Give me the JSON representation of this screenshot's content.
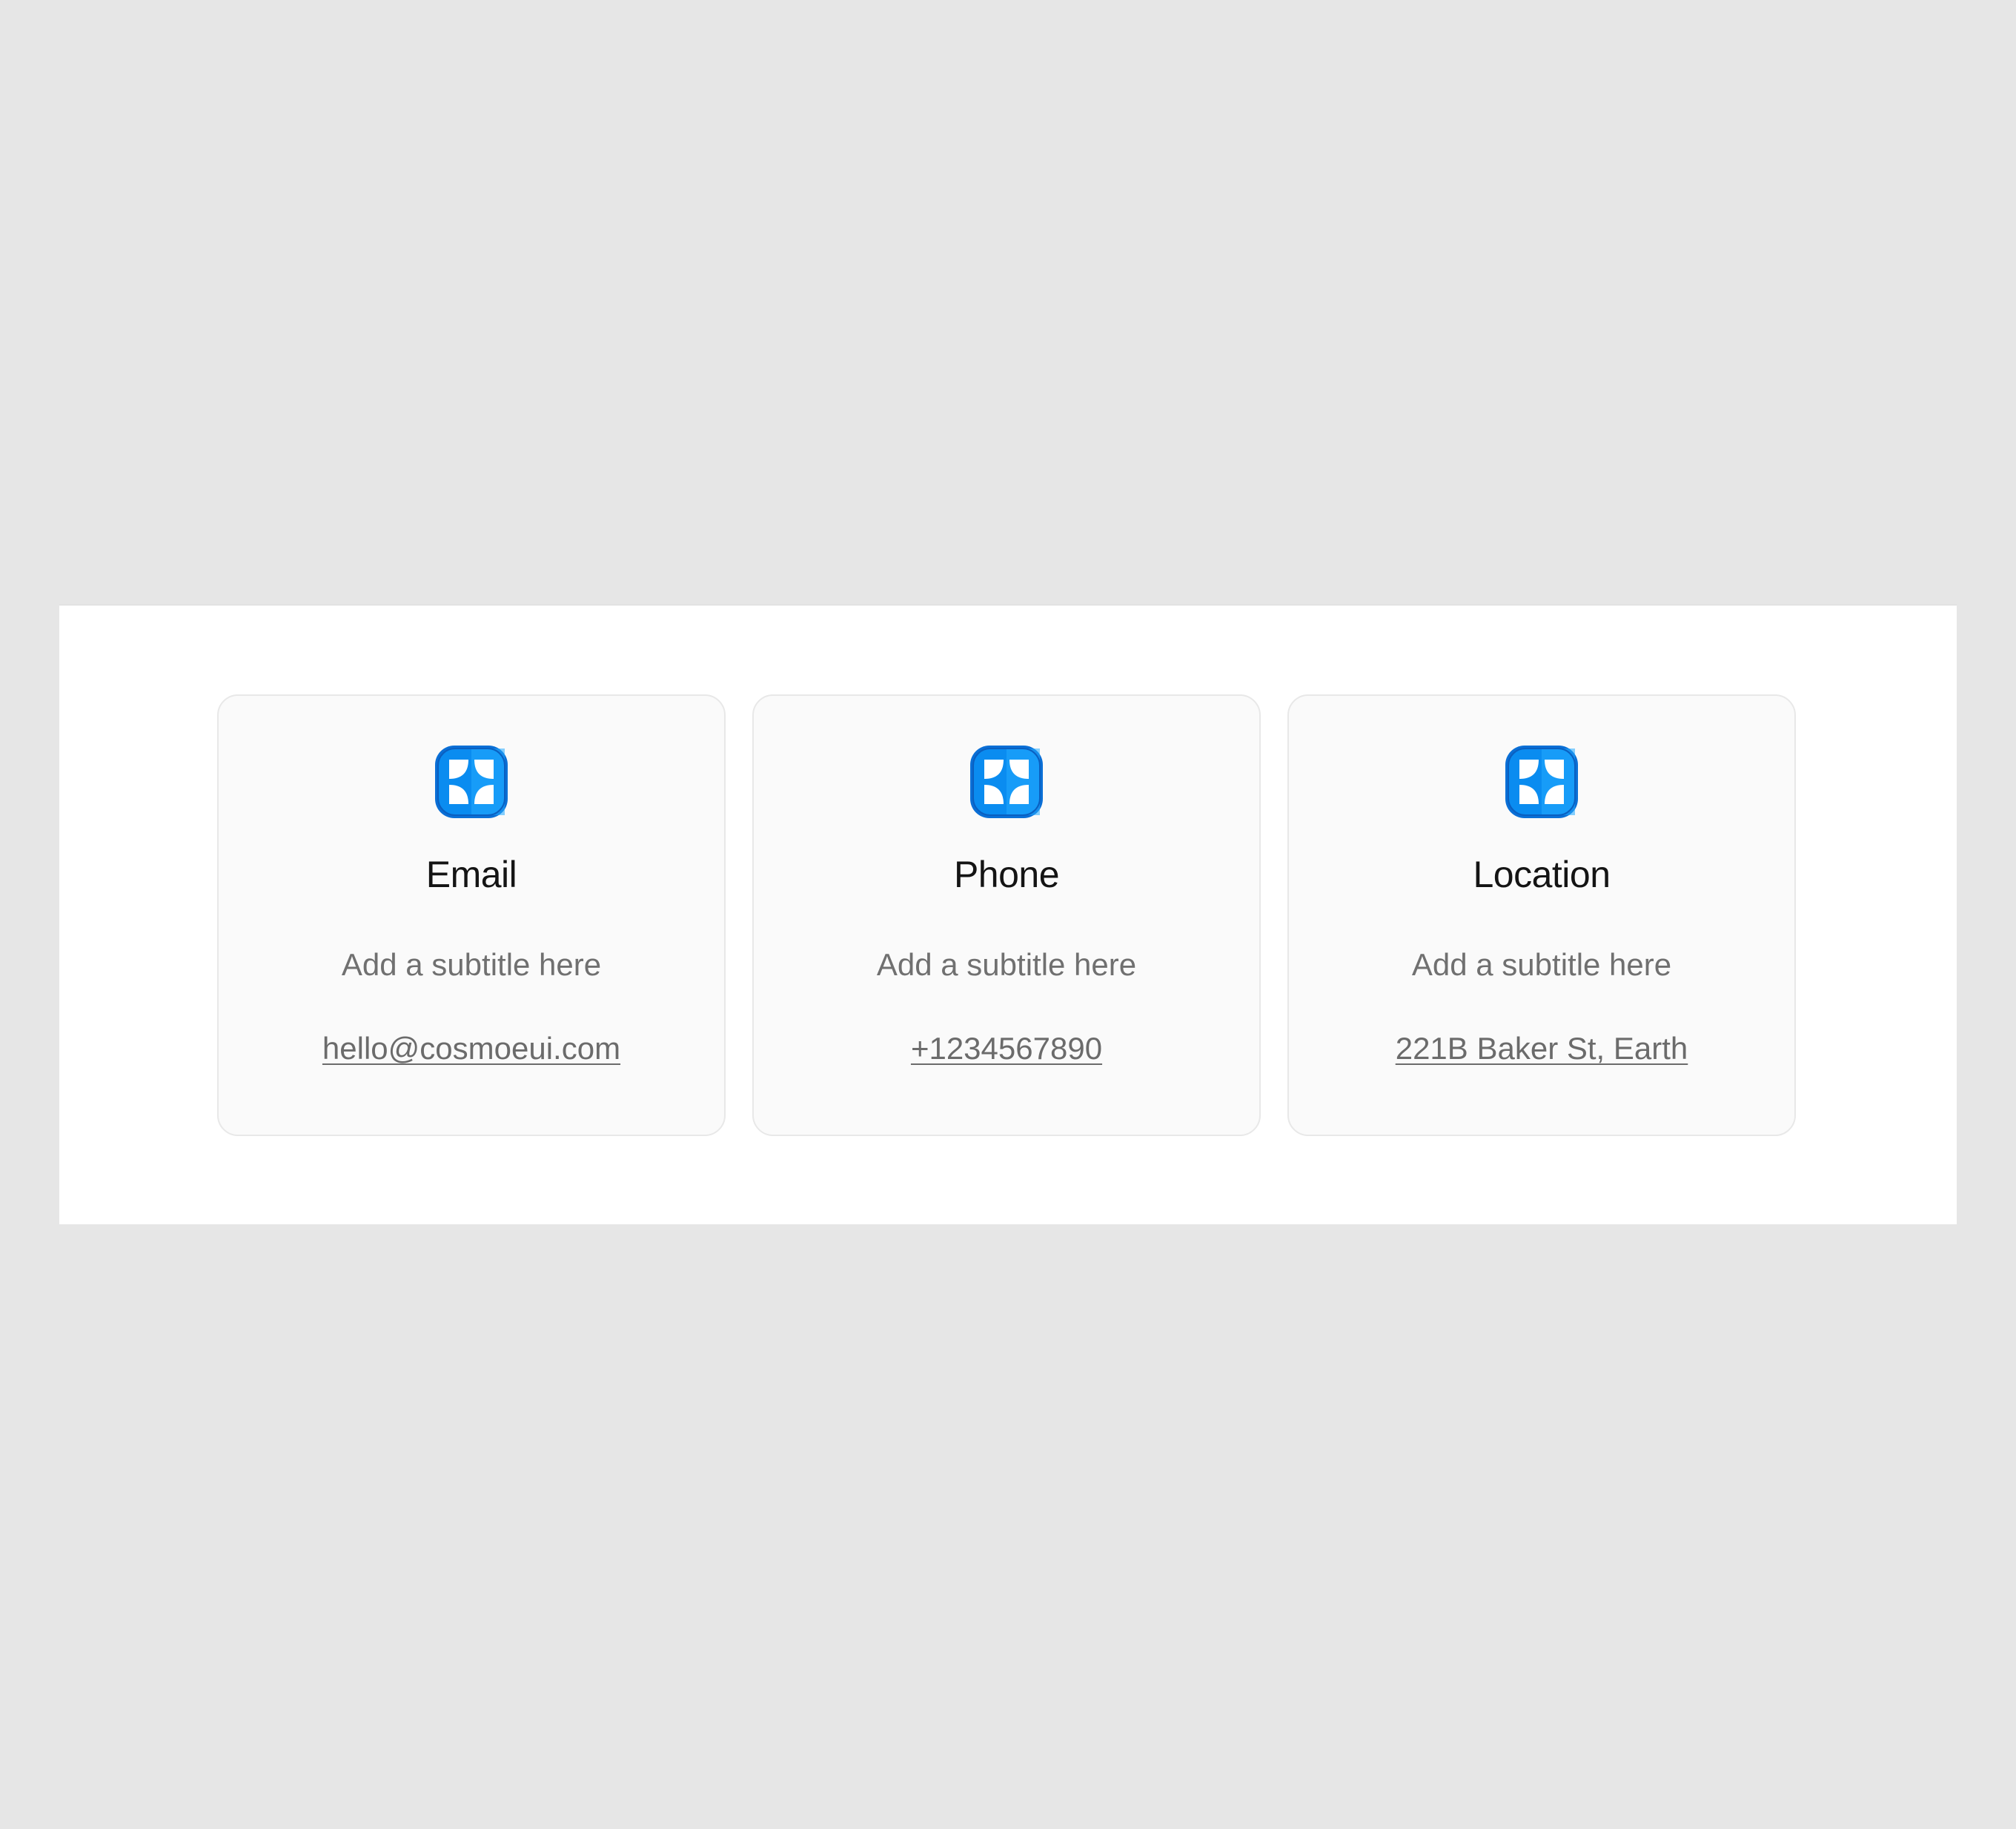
{
  "colors": {
    "page_background": "#e6e6e6",
    "panel_background": "#ffffff",
    "card_background": "#fafafa",
    "card_border": "#e8e8e8",
    "icon_blue": "#0a8cf0",
    "title_text": "#141414",
    "muted_text": "#707070"
  },
  "cards": [
    {
      "icon": "sparkle-badge-icon",
      "title": "Email",
      "subtitle": "Add a subtitle here",
      "link_text": "hello@cosmoeui.com"
    },
    {
      "icon": "sparkle-badge-icon",
      "title": "Phone",
      "subtitle": "Add a subtitle here",
      "link_text": "+1234567890"
    },
    {
      "icon": "sparkle-badge-icon",
      "title": "Location",
      "subtitle": "Add a subtitle here",
      "link_text": "221B Baker St, Earth"
    }
  ]
}
